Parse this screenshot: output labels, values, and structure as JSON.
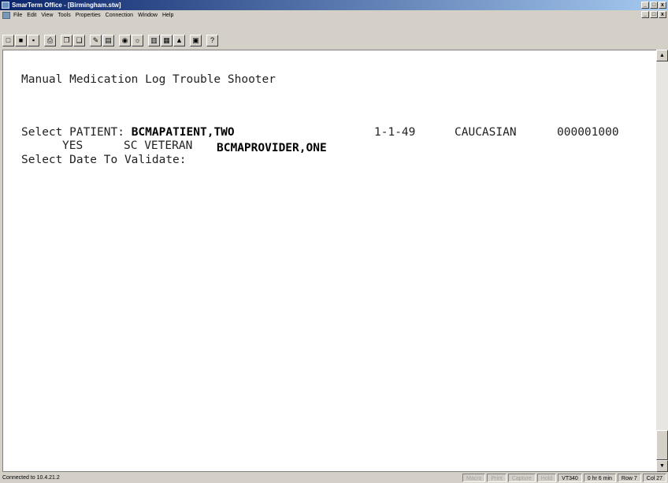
{
  "window": {
    "title": "SmarTerm Office - [Birmingham.stw]",
    "controls": [
      "_",
      "□",
      "x"
    ]
  },
  "menu": [
    "File",
    "Edit",
    "View",
    "Tools",
    "Properties",
    "Connection",
    "Window",
    "Help"
  ],
  "toolbar": {
    "buttons": [
      {
        "name": "new-icon",
        "glyph": "□"
      },
      {
        "name": "open-icon",
        "glyph": "■"
      },
      {
        "name": "save-icon",
        "glyph": "▪"
      },
      {
        "name": "print-icon",
        "glyph": "⎙"
      },
      {
        "name": "copy-icon",
        "glyph": "❐"
      },
      {
        "name": "paste-icon",
        "glyph": "❑"
      },
      {
        "name": "edit-icon",
        "glyph": "✎"
      },
      {
        "name": "macro-icon",
        "glyph": "▤"
      },
      {
        "name": "record-icon",
        "glyph": "◉"
      },
      {
        "name": "settings-icon",
        "glyph": "☼"
      },
      {
        "name": "doc-icon",
        "glyph": "▥"
      },
      {
        "name": "doc2-icon",
        "glyph": "▦"
      },
      {
        "name": "pointer-icon",
        "glyph": "▲"
      },
      {
        "name": "screen-icon",
        "glyph": "▣"
      },
      {
        "name": "help-icon",
        "glyph": "?"
      }
    ]
  },
  "terminal": {
    "title_line": "Manual Medication Log Trouble Shooter",
    "patient_prompt": "Select PATIENT: ",
    "patient_name": "BCMAPATIENT,TWO",
    "dob": "1-1-49",
    "race": "CAUCASIAN",
    "ssn": "000001000",
    "veteran_flag": "YES",
    "veteran_type": "SC VETERAN",
    "provider": "BCMAPROVIDER,ONE",
    "date_prompt": "Select Date To Validate:"
  },
  "status": {
    "connection": "Connected to 10.4.21.2",
    "panels": [
      {
        "label": "Macro",
        "dim": true
      },
      {
        "label": "Print",
        "dim": true
      },
      {
        "label": "Capture",
        "dim": true
      },
      {
        "label": "Hold",
        "dim": true
      },
      {
        "label": "VT340",
        "dim": false
      },
      {
        "label": "0 hr 6 min",
        "dim": false
      },
      {
        "label": "Row 7",
        "dim": false
      },
      {
        "label": "Col 27",
        "dim": false
      }
    ]
  },
  "scrollbar": {
    "up": "▲",
    "down": "▼"
  }
}
